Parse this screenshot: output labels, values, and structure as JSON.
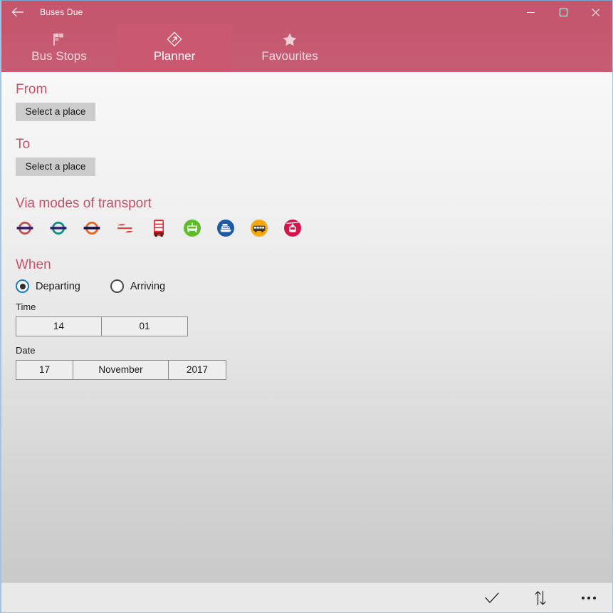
{
  "window": {
    "app_title": "Buses Due",
    "back_icon": "back-arrow-icon",
    "minimize_label": "Minimize",
    "maximize_label": "Maximize",
    "close_label": "Close",
    "accent_color": "#c4566e",
    "active_tab_color": "#ca5871"
  },
  "tabs": [
    {
      "label": "Bus Stops",
      "icon": "flag-icon",
      "active": false
    },
    {
      "label": "Planner",
      "icon": "route-diamond-icon",
      "active": true
    },
    {
      "label": "Favourites",
      "icon": "star-icon",
      "active": false
    }
  ],
  "planner": {
    "from": {
      "header": "From",
      "button_label": "Select a place"
    },
    "to": {
      "header": "To",
      "button_label": "Select a place"
    },
    "via": {
      "header": "Via modes of transport",
      "modes": [
        {
          "name": "tube",
          "label": "Tube",
          "icon": "roundel-icon",
          "color": "#c0504d",
          "bar_color": "#2d1b6b"
        },
        {
          "name": "overground",
          "label": "Overground",
          "icon": "roundel-icon",
          "color": "#0f8f8a",
          "bar_color": "#2d1b6b"
        },
        {
          "name": "dlr",
          "label": "DLR",
          "icon": "roundel-icon",
          "color": "#e8641e",
          "bar_color": "#12104a"
        },
        {
          "name": "national-rail",
          "label": "National Rail",
          "icon": "national-rail-arrows-icon",
          "color": "#d64240"
        },
        {
          "name": "bus",
          "label": "Bus",
          "icon": "double-decker-bus-icon",
          "color": "#e02b33"
        },
        {
          "name": "tram",
          "label": "Tram",
          "icon": "tram-icon",
          "color": "#60bb29"
        },
        {
          "name": "river-boat",
          "label": "River Bus",
          "icon": "ferry-icon",
          "color": "#1d5aa5"
        },
        {
          "name": "coach",
          "label": "Coach",
          "icon": "coach-icon",
          "color": "#f7a80d"
        },
        {
          "name": "cable-car",
          "label": "Cable Car",
          "icon": "cable-car-icon",
          "color": "#d4144a"
        }
      ]
    },
    "when": {
      "header": "When",
      "options": [
        {
          "label": "Departing",
          "selected": true
        },
        {
          "label": "Arriving",
          "selected": false
        }
      ],
      "time_label": "Time",
      "time": {
        "hour": "14",
        "minute": "01"
      },
      "date_label": "Date",
      "date": {
        "day": "17",
        "month": "November",
        "year": "2017"
      }
    }
  },
  "commandbar": {
    "buttons": [
      {
        "name": "accept-button",
        "icon": "check-icon",
        "label": "Plan journey"
      },
      {
        "name": "swap-button",
        "icon": "swap-arrows-icon",
        "label": "Swap from and to"
      },
      {
        "name": "more-button",
        "icon": "ellipsis-icon",
        "label": "See more"
      }
    ]
  }
}
